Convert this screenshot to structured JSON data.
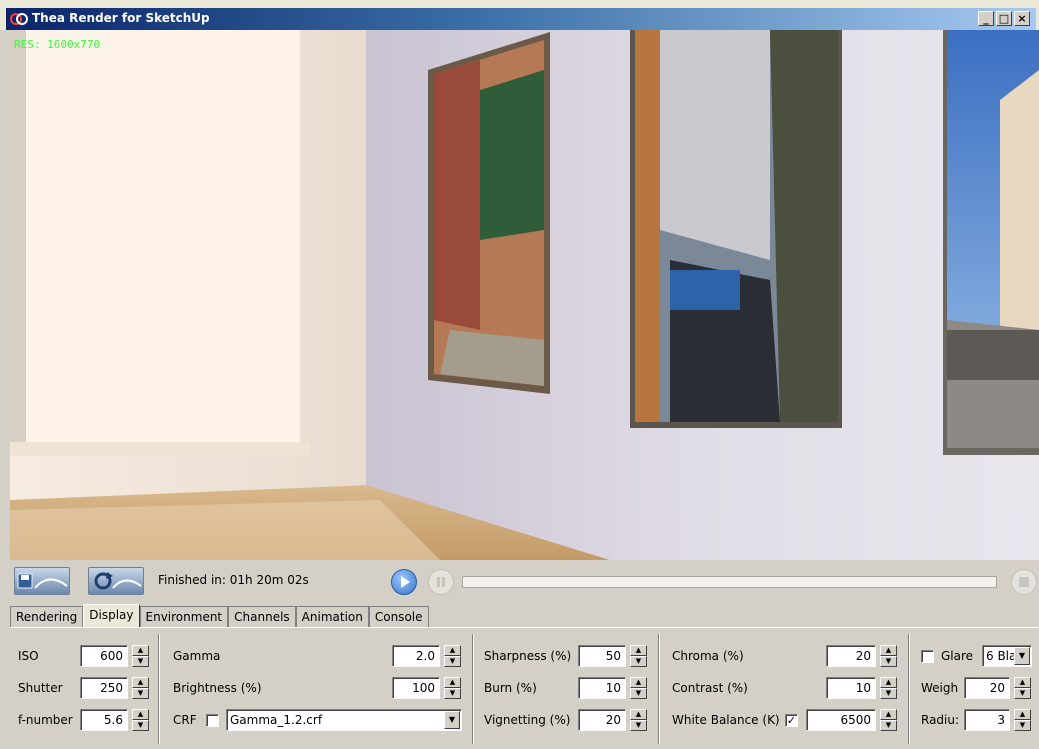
{
  "window": {
    "title": "Thea Render for SketchUp",
    "minimize": "_",
    "maximize": "□",
    "close": "×"
  },
  "viewport": {
    "resolution_label": "RES: 1600x770"
  },
  "progress": {
    "status": "Finished in: 01h 20m 02s"
  },
  "tabs": [
    "Rendering",
    "Display",
    "Environment",
    "Channels",
    "Animation",
    "Console"
  ],
  "active_tab": "Display",
  "camera": {
    "iso_label": "ISO",
    "iso_value": "600",
    "shutter_label": "Shutter",
    "shutter_value": "250",
    "fnumber_label": "f-number",
    "fnumber_value": "5.6"
  },
  "tone": {
    "gamma_label": "Gamma",
    "gamma_value": "2.0",
    "brightness_label": "Brightness (%)",
    "brightness_value": "100",
    "crf_label": "CRF",
    "crf_checked": false,
    "crf_file": "Gamma_1.2.crf"
  },
  "effects": {
    "sharpness_label": "Sharpness (%)",
    "sharpness_value": "50",
    "burn_label": "Burn (%)",
    "burn_value": "10",
    "vignetting_label": "Vignetting (%)",
    "vignetting_value": "20"
  },
  "color": {
    "chroma_label": "Chroma (%)",
    "chroma_value": "20",
    "contrast_label": "Contrast (%)",
    "contrast_value": "10",
    "wb_label": "White Balance (K)",
    "wb_checked": true,
    "wb_value": "6500"
  },
  "glare": {
    "glare_label": "Glare",
    "glare_checked": false,
    "glare_type": "6 Bla",
    "weight_label": "Weigh",
    "weight_value": "20",
    "radius_label": "Radiu:",
    "radius_value": "3"
  },
  "colors": {
    "title_gradient_start": "#0a246a",
    "res_label": "#33ff33",
    "panel_bg": "#d4d0c8"
  }
}
